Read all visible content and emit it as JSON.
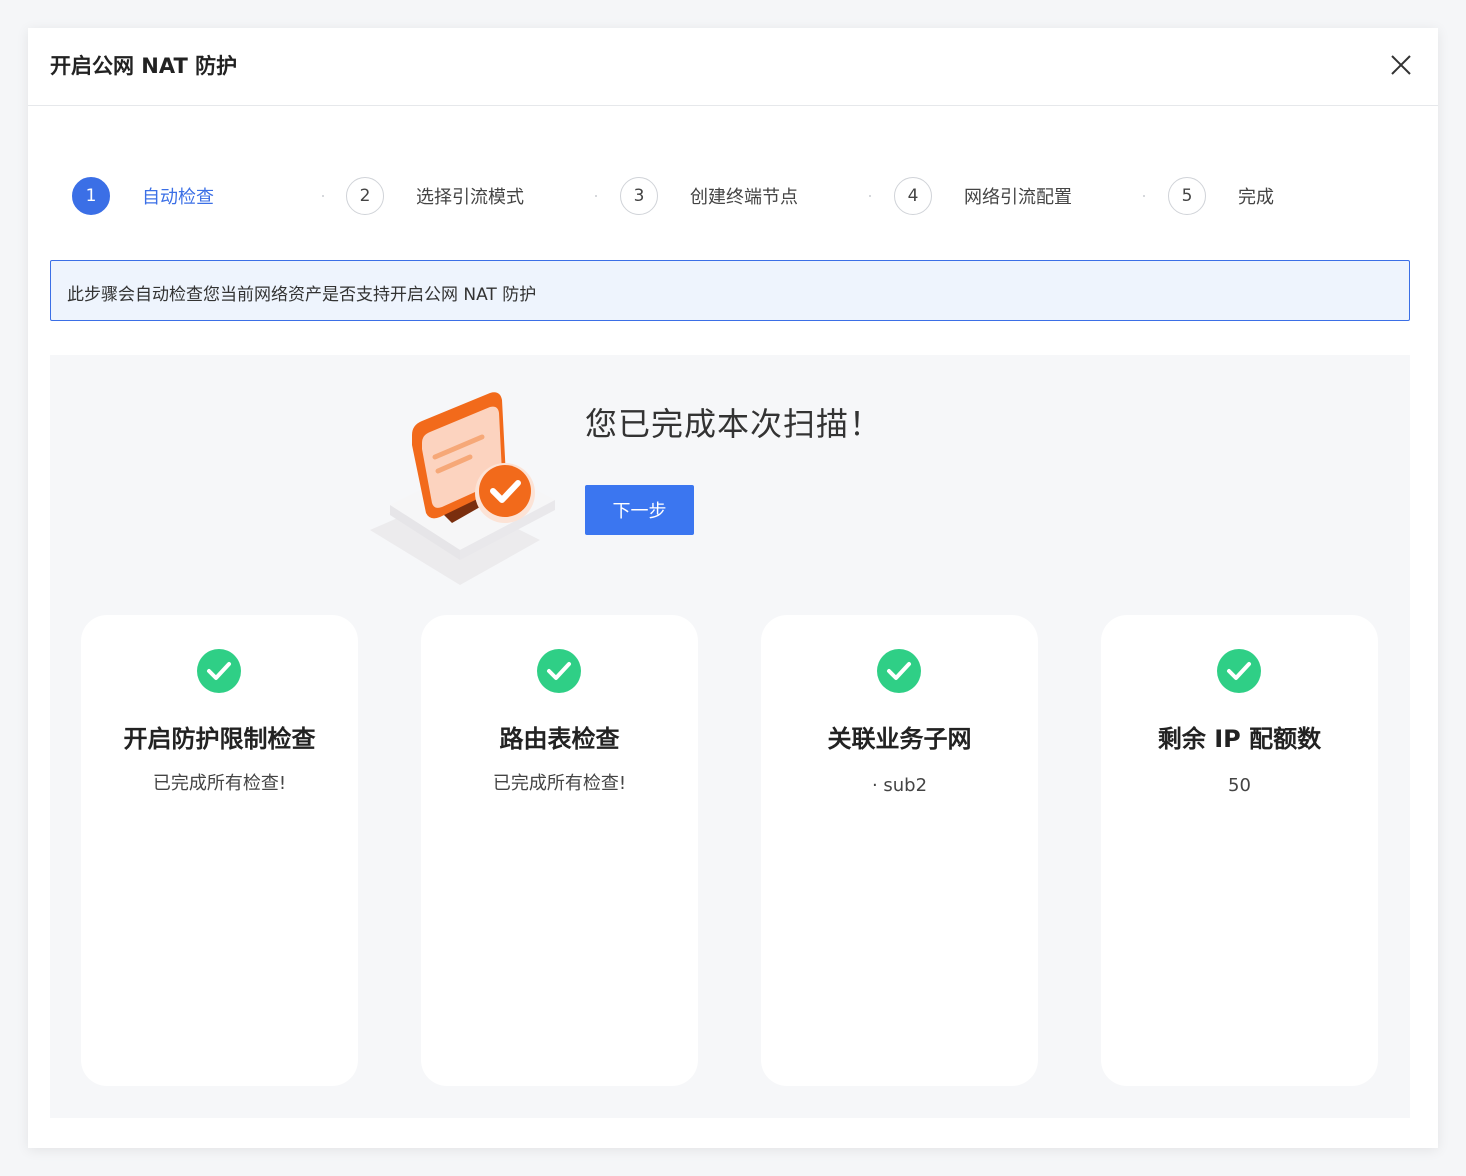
{
  "dialog": {
    "title": "开启公网 NAT 防护",
    "close_icon": "close-icon"
  },
  "steps": [
    {
      "number": "1",
      "label": "自动检查",
      "state": "active"
    },
    {
      "number": "2",
      "label": "选择引流模式",
      "state": "pending"
    },
    {
      "number": "3",
      "label": "创建终端节点",
      "state": "pending"
    },
    {
      "number": "4",
      "label": "网络引流配置",
      "state": "pending"
    },
    {
      "number": "5",
      "label": "完成",
      "state": "pending"
    }
  ],
  "info": {
    "text": "此步骤会自动检查您当前网络资产是否支持开启公网 NAT 防护"
  },
  "result": {
    "title": "您已完成本次扫描！",
    "next_button": "下一步",
    "illustration_icon": "scan-complete-illustration"
  },
  "cards": [
    {
      "title": "开启防护限制检查",
      "desc": "已完成所有检查!",
      "icon": "check-circle-icon"
    },
    {
      "title": "路由表检查",
      "desc": "已完成所有检查!",
      "icon": "check-circle-icon"
    },
    {
      "title": "关联业务子网",
      "desc": "· sub2",
      "icon": "check-circle-icon"
    },
    {
      "title": "剩余 IP 配额数",
      "desc": "50",
      "icon": "check-circle-icon"
    }
  ],
  "colors": {
    "primary": "#3b6fe6",
    "success": "#2fcf86",
    "info_bg": "#eef4fd",
    "panel_bg": "#f6f7f9",
    "accent_orange": "#f26a1b"
  }
}
